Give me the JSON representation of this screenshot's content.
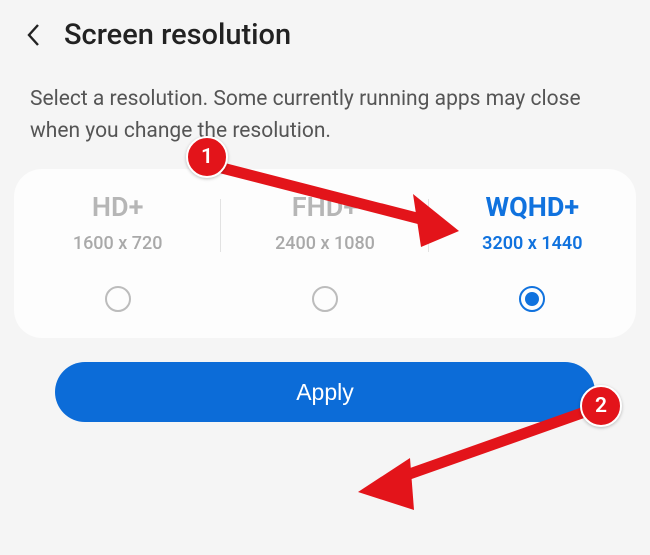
{
  "header": {
    "title": "Screen resolution"
  },
  "description": "Select a resolution. Some currently running apps may close when you change the resolution.",
  "options": [
    {
      "label": "HD+",
      "res": "1600 x 720",
      "selected": false
    },
    {
      "label": "FHD+",
      "res": "2400 x 1080",
      "selected": false
    },
    {
      "label": "WQHD+",
      "res": "3200 x 1440",
      "selected": true
    }
  ],
  "apply_label": "Apply",
  "annotations": {
    "step1": "1",
    "step2": "2"
  }
}
